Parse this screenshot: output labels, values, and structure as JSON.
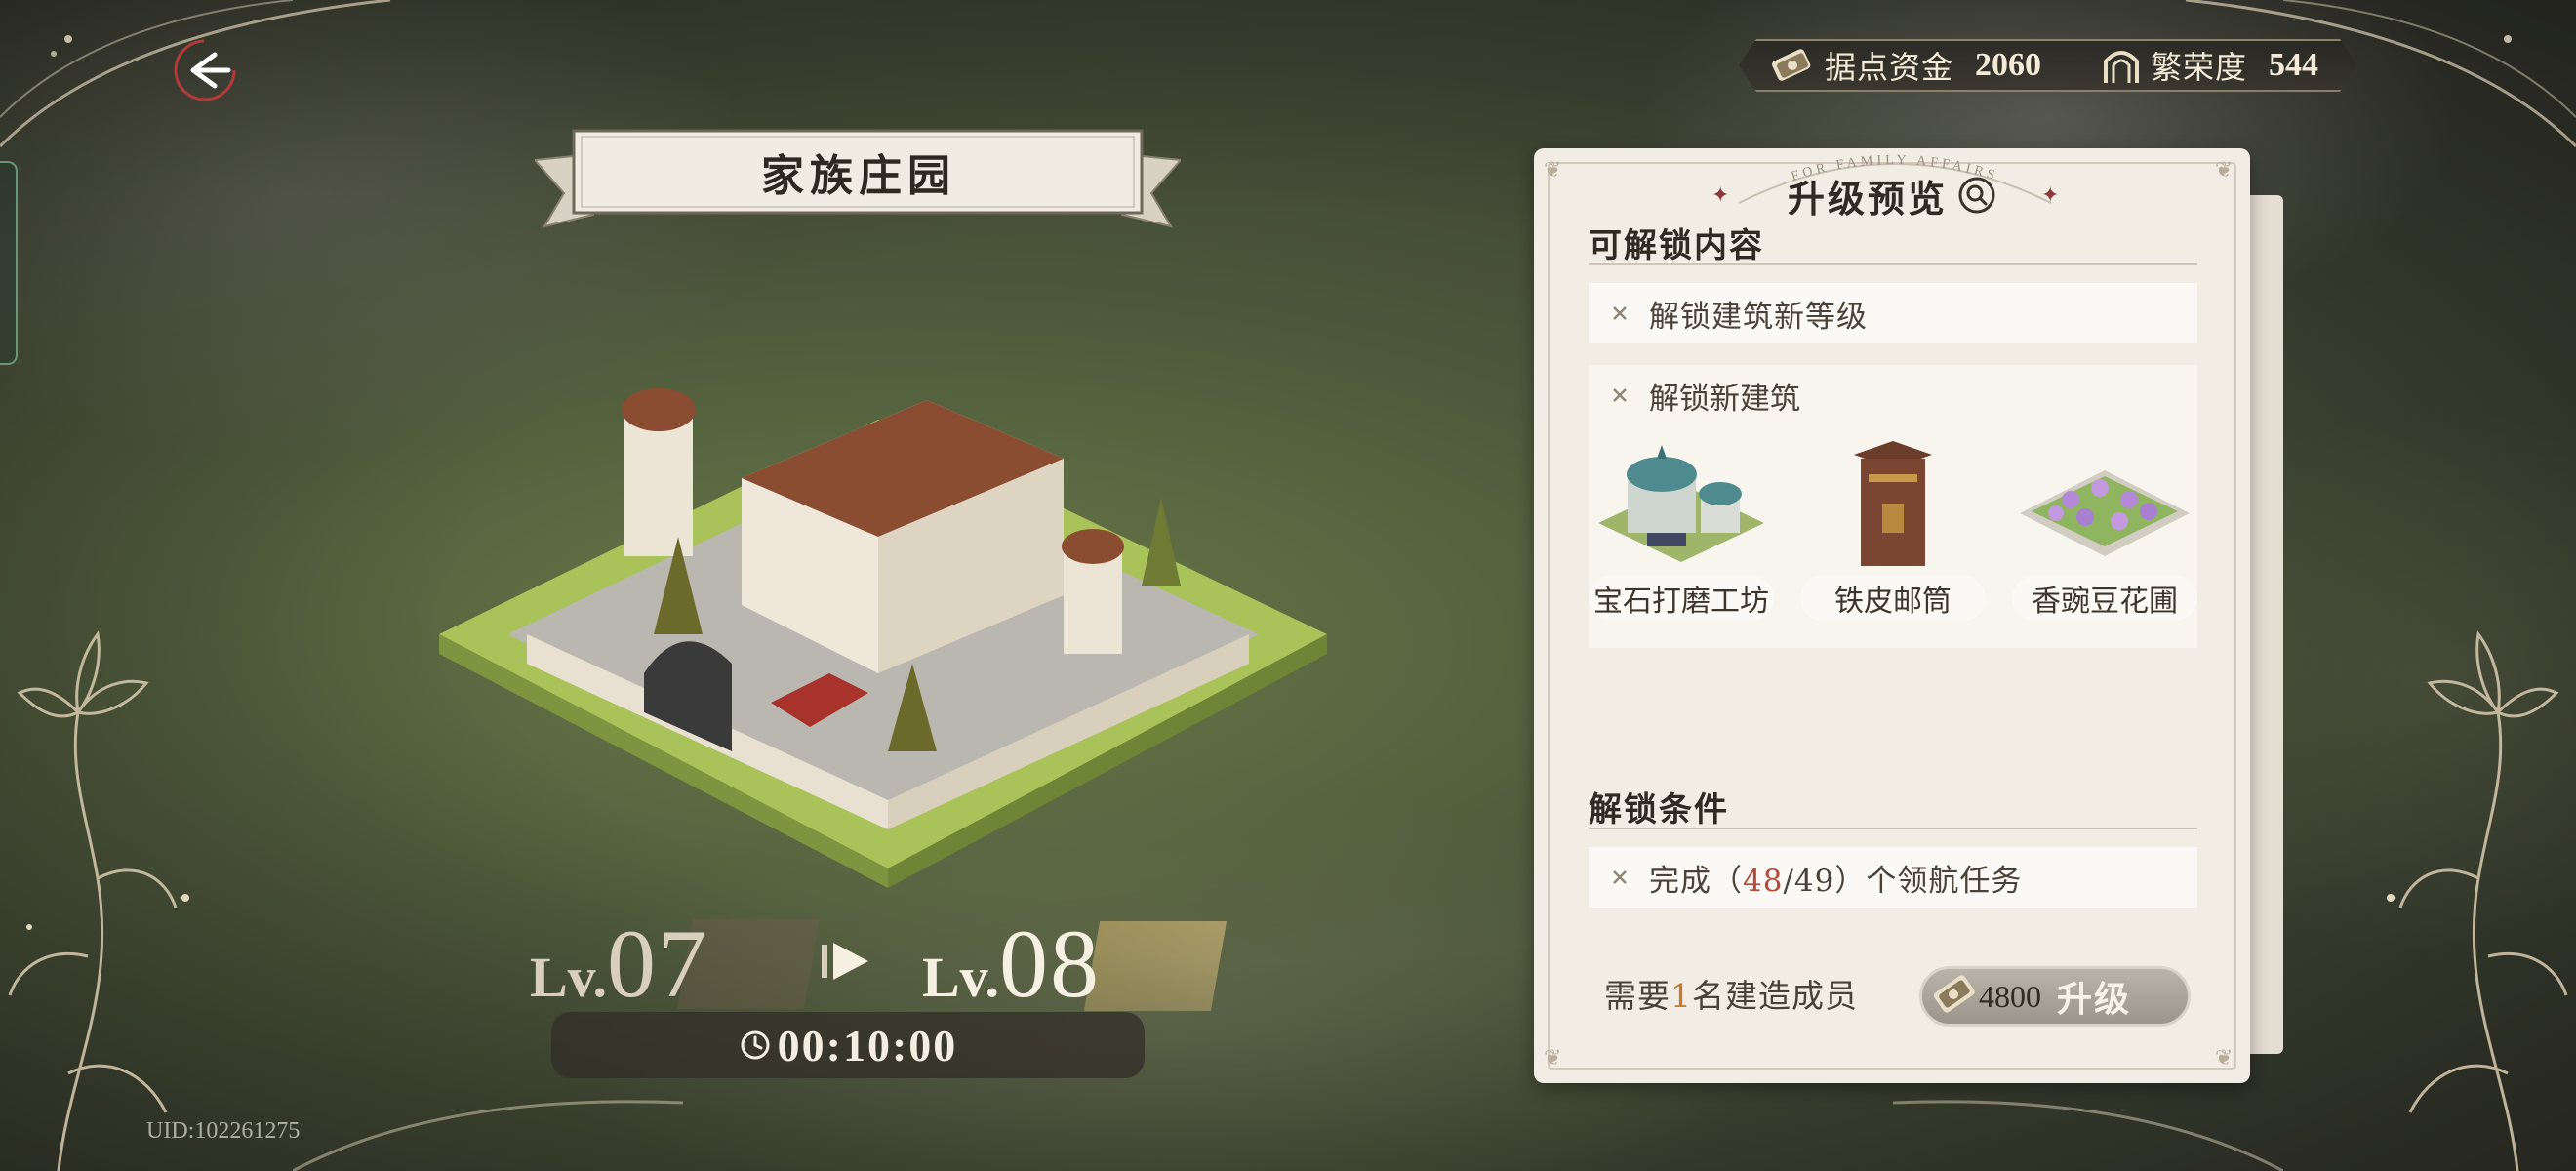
{
  "header": {
    "title": "家族庄园",
    "back_icon": "back-arrow-icon"
  },
  "resources": {
    "fund_label": "据点资金",
    "fund_value": "2060",
    "prosperity_label": "繁荣度",
    "prosperity_value": "544"
  },
  "level": {
    "current_prefix": "Lv.",
    "current_num": "07",
    "next_prefix": "Lv.",
    "next_num": "08",
    "timer": "00:10:00"
  },
  "uid": "UID:102261275",
  "panel": {
    "arch_text": "FOR FAMILY AFFAIRS",
    "title": "升级预览",
    "unlock_section": "可解锁内容",
    "unlock_level": "解锁建筑新等级",
    "unlock_buildings": "解锁新建筑",
    "buildings": [
      {
        "name": "宝石打磨工坊",
        "icon": "gem-workshop-icon"
      },
      {
        "name": "铁皮邮筒",
        "icon": "mailbox-icon"
      },
      {
        "name": "香豌豆花圃",
        "icon": "flower-bed-icon"
      }
    ],
    "condition_section": "解锁条件",
    "condition_prefix": "完成（",
    "condition_done": "48",
    "condition_total": "/49）个领航任务",
    "builder_prefix": "需要",
    "builder_count": "1",
    "builder_suffix": "名建造成员",
    "upgrade_cost": "4800",
    "upgrade_label": "升级"
  },
  "colors": {
    "highlight_red": "#b24a3c",
    "highlight_orange": "#c4792e",
    "panel_bg": "#f1ede5"
  }
}
